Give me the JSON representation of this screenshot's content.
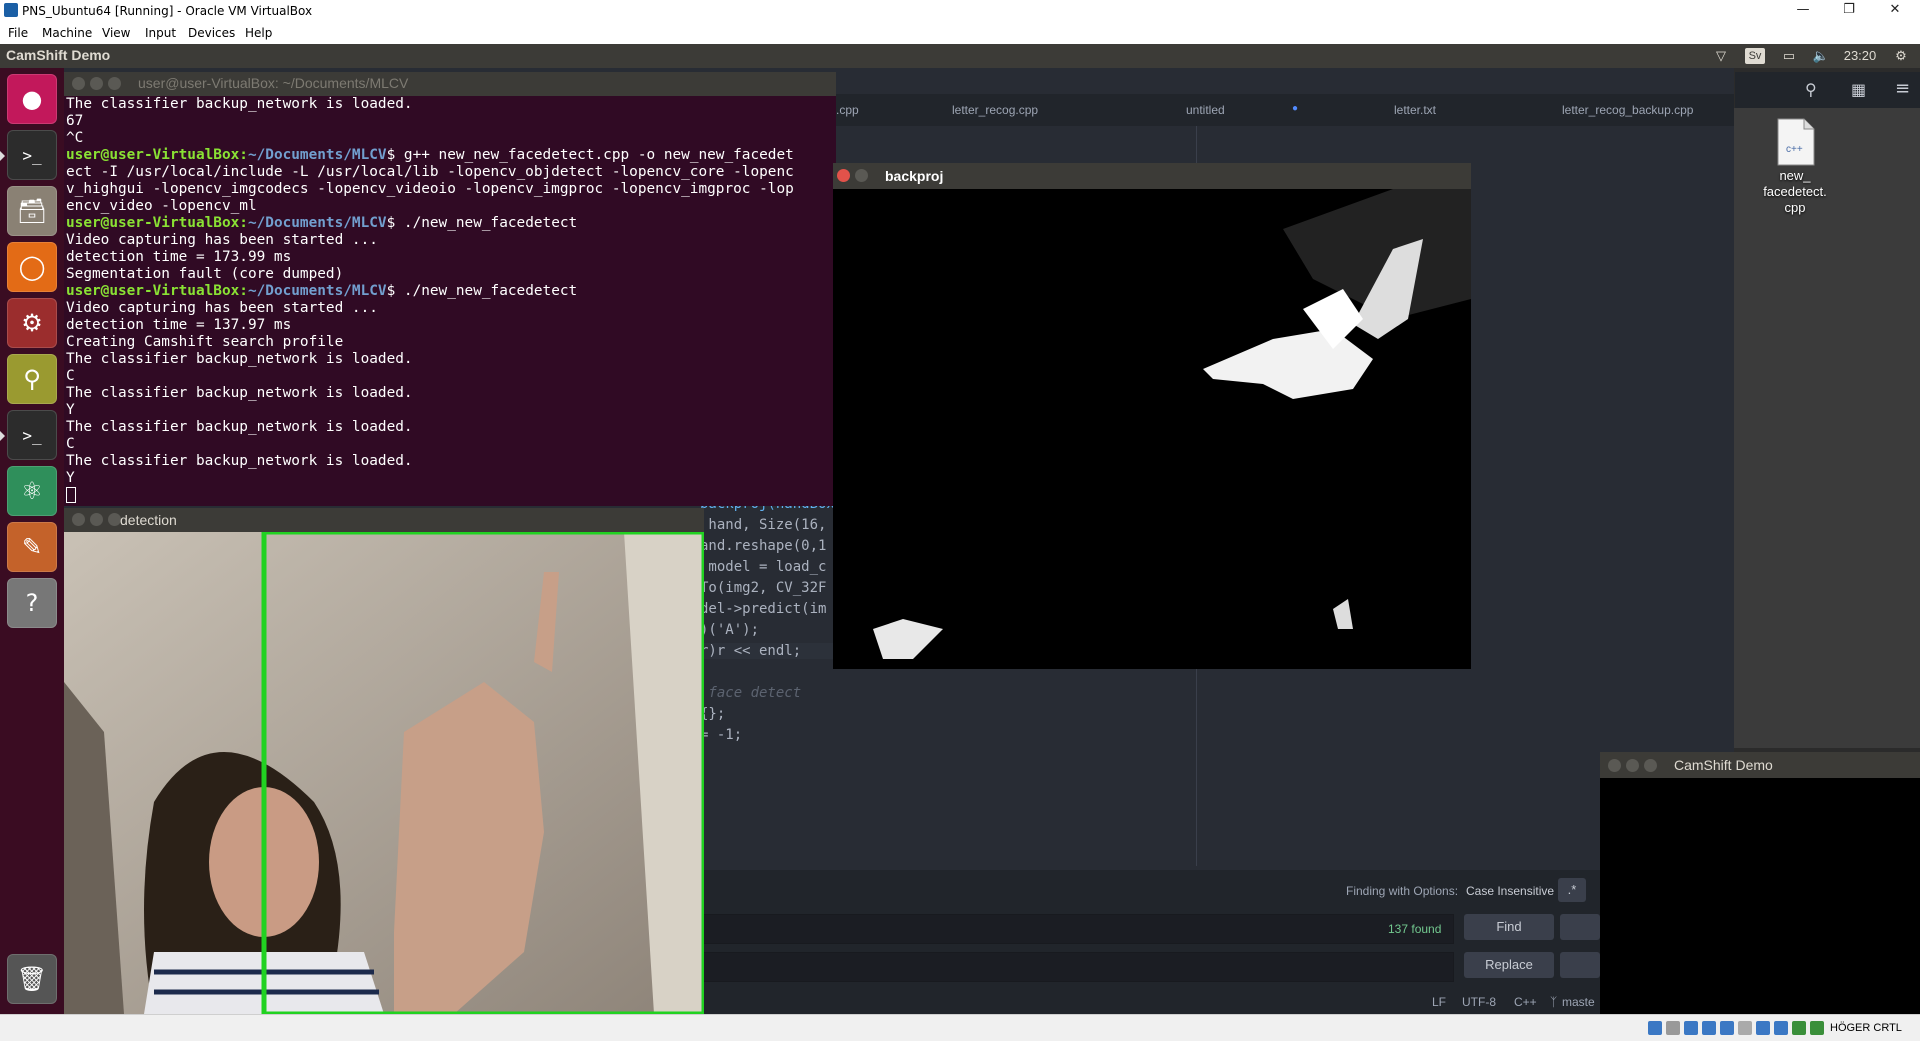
{
  "host": {
    "title": "PNS_Ubuntu64 [Running] - Oracle VM VirtualBox",
    "menu": [
      "File",
      "Machine",
      "View",
      "Input",
      "Devices",
      "Help"
    ],
    "status_right": "HÖGER CRTL"
  },
  "ubuntu_panel": {
    "app_name": "CamShift Demo",
    "keyboard_layout": "Sv",
    "clock": "23:20"
  },
  "launcher": {
    "items": [
      "ubuntu-dash",
      "terminal",
      "files",
      "firefox",
      "system-settings",
      "image-viewer",
      "terminal-2",
      "atom",
      "text-editor",
      "help",
      "trash"
    ]
  },
  "terminal": {
    "title": "user@user-VirtualBox: ~/Documents/MLCV",
    "lines": [
      {
        "type": "text",
        "text": "The classifier backup_network is loaded."
      },
      {
        "type": "text",
        "text": "67"
      },
      {
        "type": "text",
        "text": "^C"
      },
      {
        "type": "prompt",
        "user": "user@user-VirtualBox",
        "path": "~/Documents/MLCV",
        "cmd": "$ g++ new_new_facedetect.cpp -o new_new_facedet"
      },
      {
        "type": "text",
        "text": "ect -I /usr/local/include -L /usr/local/lib -lopencv_objdetect -lopencv_core -lopenc"
      },
      {
        "type": "text",
        "text": "v_highgui -lopencv_imgcodecs -lopencv_videoio -lopencv_imgproc -lopencv_imgproc -lop"
      },
      {
        "type": "text",
        "text": "encv_video -lopencv_ml"
      },
      {
        "type": "prompt",
        "user": "user@user-VirtualBox",
        "path": "~/Documents/MLCV",
        "cmd": "$ ./new_new_facedetect"
      },
      {
        "type": "text",
        "text": "Video capturing has been started ..."
      },
      {
        "type": "text",
        "text": "detection time = 173.99 ms"
      },
      {
        "type": "text",
        "text": "Segmentation fault (core dumped)"
      },
      {
        "type": "prompt",
        "user": "user@user-VirtualBox",
        "path": "~/Documents/MLCV",
        "cmd": "$ ./new_new_facedetect"
      },
      {
        "type": "text",
        "text": "Video capturing has been started ..."
      },
      {
        "type": "text",
        "text": "detection time = 137.97 ms"
      },
      {
        "type": "text",
        "text": "Creating Camshift search profile"
      },
      {
        "type": "text",
        "text": "The classifier backup_network is loaded."
      },
      {
        "type": "text",
        "text": "C"
      },
      {
        "type": "text",
        "text": "The classifier backup_network is loaded."
      },
      {
        "type": "text",
        "text": "Y"
      },
      {
        "type": "text",
        "text": "The classifier backup_network is loaded."
      },
      {
        "type": "text",
        "text": "C"
      },
      {
        "type": "text",
        "text": "The classifier backup_network is loaded."
      },
      {
        "type": "text",
        "text": "Y"
      }
    ]
  },
  "editor": {
    "tabs": [
      ".cpp",
      "letter_recog.cpp",
      "untitled",
      "letter.txt",
      "letter_recog_backup.cpp"
    ],
    "code": [
      "backproj(handBox",
      " hand, Size(16,",
      "and.reshape(0,1",
      " model = load_c",
      "To(img2, CV_32F",
      "del->predict(im",
      ")('A');",
      "r)r << endl;",
      "",
      " face detect",
      "{};",
      "= -1;"
    ],
    "find": {
      "options_label": "Finding with Options:",
      "options_value": "Case Insensitive",
      "regex_label": ".*",
      "found": "137 found",
      "find_button": "Find",
      "replace_button": "Replace"
    },
    "status": {
      "line_ending": "LF",
      "encoding": "UTF-8",
      "grammar": "C++",
      "branch": "maste"
    }
  },
  "desktop": {
    "file_label": "new_\nfacedetect.\ncpp",
    "file_icon_text": "c++"
  },
  "windows": {
    "detection_title": "detection",
    "backproj_title": "backproj",
    "camshift_title": "CamShift Demo"
  }
}
